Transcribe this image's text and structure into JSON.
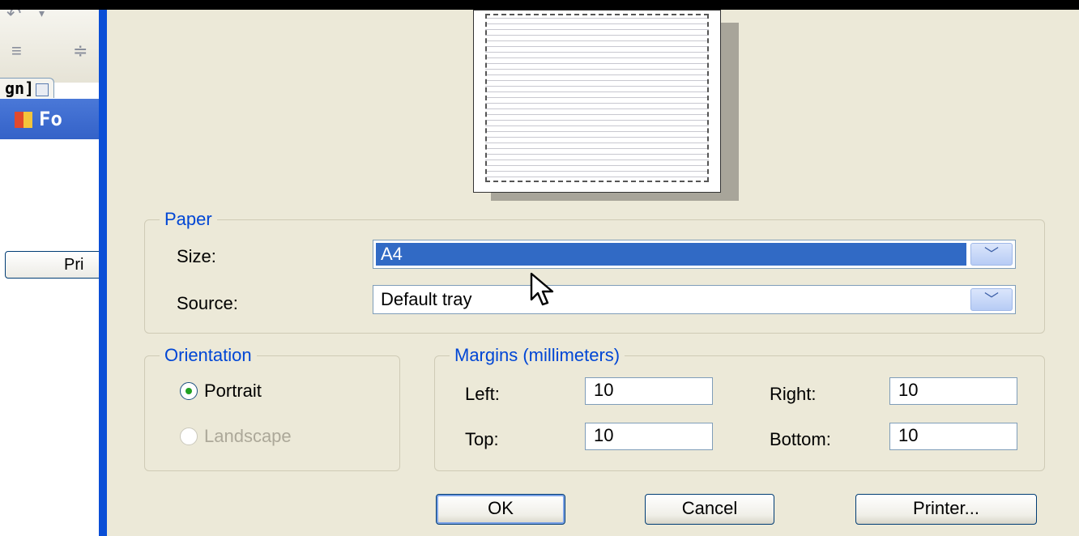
{
  "background_app": {
    "tab_label": "gn]",
    "header_label": "Fo",
    "print_button_label": "Pri"
  },
  "paper": {
    "legend": "Paper",
    "size_label": "Size:",
    "size_value": "A4",
    "source_label": "Source:",
    "source_value": "Default tray"
  },
  "orientation": {
    "legend": "Orientation",
    "portrait_label": "Portrait",
    "landscape_label": "Landscape",
    "selected": "portrait"
  },
  "margins": {
    "legend": "Margins (millimeters)",
    "left_label": "Left:",
    "left_value": "10",
    "right_label": "Right:",
    "right_value": "10",
    "top_label": "Top:",
    "top_value": "10",
    "bottom_label": "Bottom:",
    "bottom_value": "10"
  },
  "buttons": {
    "ok": "OK",
    "cancel": "Cancel",
    "printer": "Printer..."
  },
  "colors": {
    "accent_blue": "#0046d5",
    "selection": "#316ac5",
    "dialog_bg": "#ece9d8"
  }
}
